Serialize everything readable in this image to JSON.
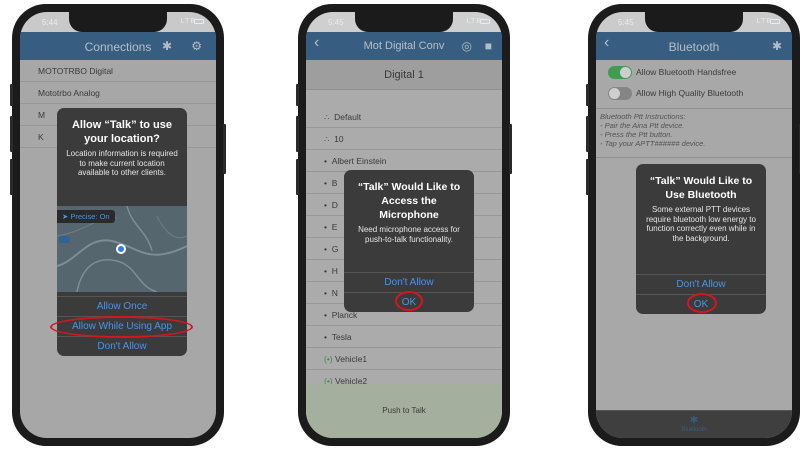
{
  "accent": "#2f6394",
  "highlight": "#d4161f",
  "phone1": {
    "time": "5:44",
    "signal": "LTE",
    "nav_title": "Connections",
    "icons": [
      "bluetooth-icon",
      "gear-icon"
    ],
    "list": [
      "MOTOTRBO Digital",
      "Mototrbo Analog",
      "M",
      "K"
    ],
    "alert": {
      "title": "Allow “Talk” to use your location?",
      "message": "Location information is required to make current location available to other clients.",
      "precise": "Precise: On",
      "buttons": [
        "Allow Once",
        "Allow While Using App",
        "Don't Allow"
      ]
    }
  },
  "phone2": {
    "time": "5:45",
    "signal": "LTE",
    "nav_title": "Mot Digital Conv",
    "header": "Digital 1",
    "list": [
      "Default",
      "10",
      "Albert Einstein",
      "B",
      "D",
      "E",
      "G",
      "H",
      "N",
      "Planck",
      "Tesla",
      "Vehicle1",
      "Vehicle2"
    ],
    "footer": "Push to Talk",
    "alert": {
      "title": "“Talk” Would Like to Access the Microphone",
      "message": "Need microphone access for push-to-talk functionality.",
      "buttons": [
        "Don't Allow",
        "OK"
      ]
    }
  },
  "phone3": {
    "time": "5:45",
    "signal": "LTE",
    "nav_title": "Bluetooth",
    "toggles": [
      "Allow Bluetooth Handsfree",
      "Allow High Quality Bluetooth"
    ],
    "instructions_title": "Bluetooth Ptt Instructions:",
    "instructions": [
      "- Pair the Aina Ptt device.",
      "- Press the Ptt button.",
      "- Tap your APTT###### device."
    ],
    "tab_label": "Bluetooth",
    "alert": {
      "title": "“Talk” Would Like to Use Bluetooth",
      "message": "Some external PTT devices require bluetooth low energy to function correctly even while in the background.",
      "buttons": [
        "Don't Allow",
        "OK"
      ]
    }
  }
}
